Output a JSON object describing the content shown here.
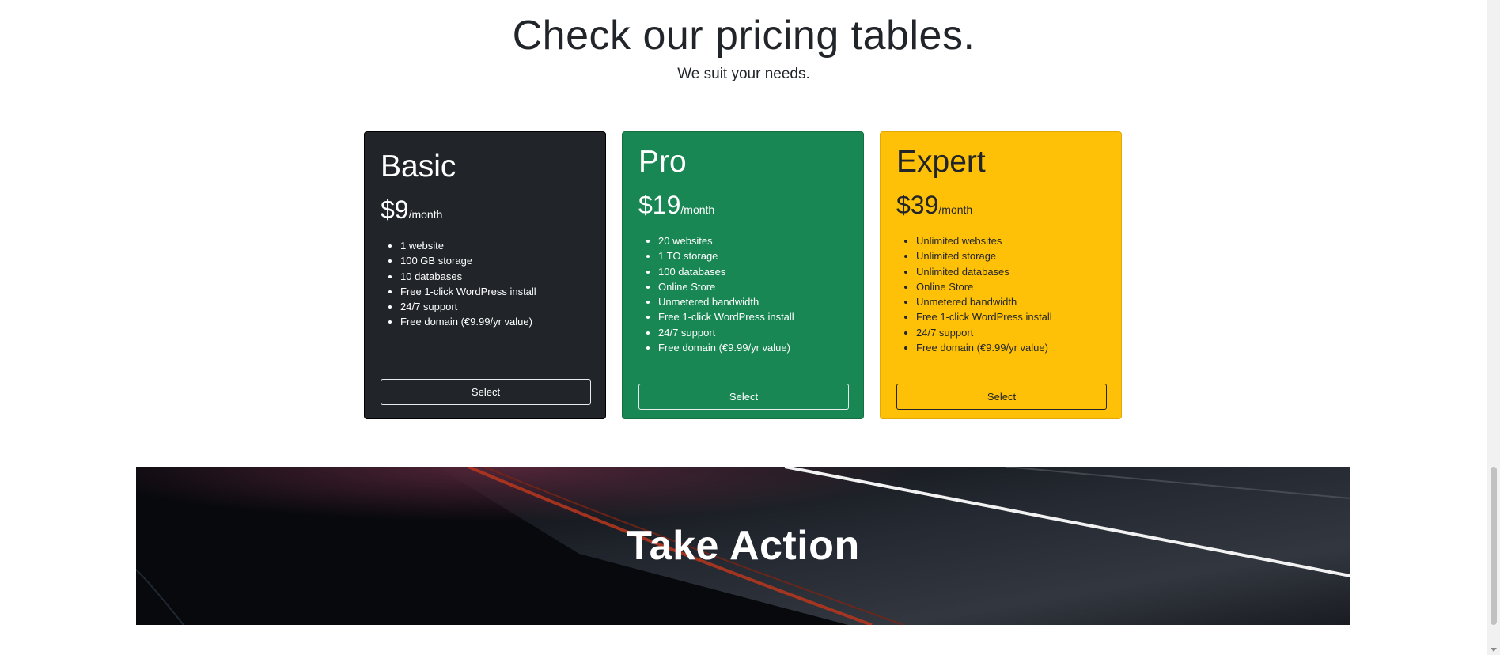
{
  "pricing": {
    "title": "Check our pricing tables.",
    "subtitle": "We suit your needs.",
    "plans": [
      {
        "name": "Basic",
        "price": "$9",
        "period": "/month",
        "features": [
          "1 website",
          "100 GB storage",
          "10 databases",
          "Free 1-click WordPress install",
          "24/7 support",
          "Free domain (€9.99/yr value)"
        ],
        "button_label": "Select",
        "color": "#212529"
      },
      {
        "name": "Pro",
        "price": "$19",
        "period": "/month",
        "features": [
          "20 websites",
          "1 TO storage",
          "100 databases",
          "Online Store",
          "Unmetered bandwidth",
          "Free 1-click WordPress install",
          "24/7 support",
          "Free domain (€9.99/yr value)"
        ],
        "button_label": "Select",
        "color": "#198754"
      },
      {
        "name": "Expert",
        "price": "$39",
        "period": "/month",
        "features": [
          "Unlimited websites",
          "Unlimited storage",
          "Unlimited databases",
          "Online Store",
          "Unmetered bandwidth",
          "Free 1-click WordPress install",
          "24/7 support",
          "Free domain (€9.99/yr value)"
        ],
        "button_label": "Select",
        "color": "#ffc107"
      }
    ]
  },
  "cta": {
    "title": "Take Action"
  }
}
